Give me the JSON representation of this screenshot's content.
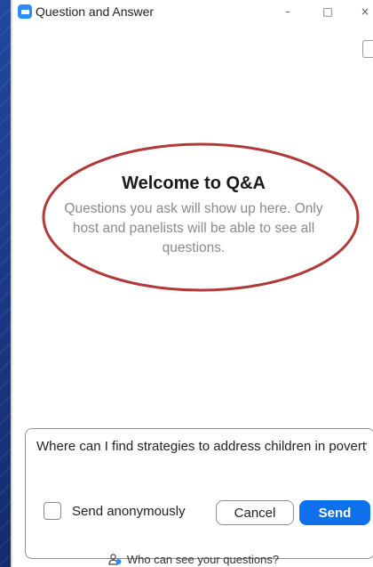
{
  "window": {
    "title": "Question and Answer",
    "controls": {
      "minimize": "–",
      "maximize": "□",
      "close": "×"
    }
  },
  "welcome": {
    "title": "Welcome to Q&A",
    "subtitle": "Questions you ask will show up here. Only host and panelists will be able to see all questions."
  },
  "composer": {
    "question_value": "Where can I find strategies to address children in poverty?",
    "anonymous_label": "Send anonymously",
    "anonymous_checked": false,
    "cancel_label": "Cancel",
    "send_label": "Send"
  },
  "footer": {
    "link_label": "Who can see your questions?"
  },
  "colors": {
    "accent": "#0e71eb",
    "app_icon": "#2d8cff",
    "highlight_ellipse": "#b03a3a",
    "background": "#1f3a88"
  }
}
